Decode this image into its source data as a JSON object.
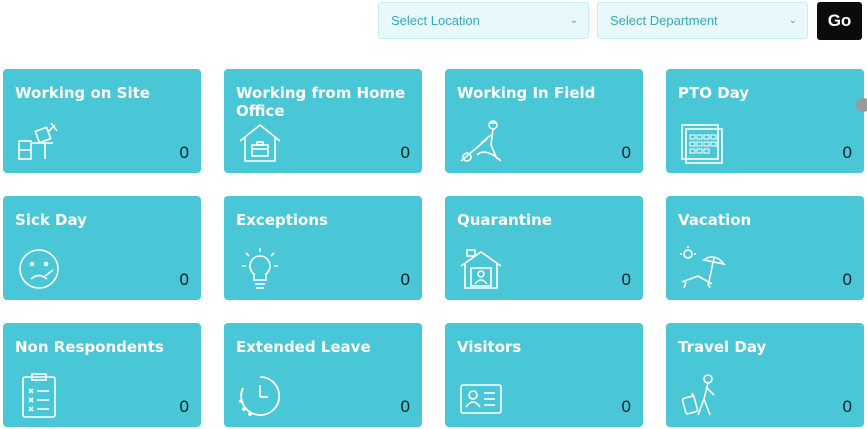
{
  "filters": {
    "location": "Select Location",
    "department": "Select Department",
    "go_label": "Go"
  },
  "cards": [
    {
      "title": "Working on Site",
      "count": "0",
      "icon": "office-desk-icon"
    },
    {
      "title": "Working from Home Office",
      "count": "0",
      "icon": "home-office-icon"
    },
    {
      "title": "Working In Field",
      "count": "0",
      "icon": "field-worker-icon"
    },
    {
      "title": "PTO Day",
      "count": "0",
      "icon": "calendar-icon"
    },
    {
      "title": "Sick Day",
      "count": "0",
      "icon": "sick-face-icon"
    },
    {
      "title": "Exceptions",
      "count": "0",
      "icon": "lightbulb-icon"
    },
    {
      "title": "Quarantine",
      "count": "0",
      "icon": "quarantine-house-icon"
    },
    {
      "title": "Vacation",
      "count": "0",
      "icon": "beach-icon"
    },
    {
      "title": "Non Respondents",
      "count": "0",
      "icon": "checklist-icon"
    },
    {
      "title": "Extended Leave",
      "count": "0",
      "icon": "clock-icon"
    },
    {
      "title": "Visitors",
      "count": "0",
      "icon": "visitor-badge-icon"
    },
    {
      "title": "Travel Day",
      "count": "0",
      "icon": "traveler-icon"
    }
  ]
}
